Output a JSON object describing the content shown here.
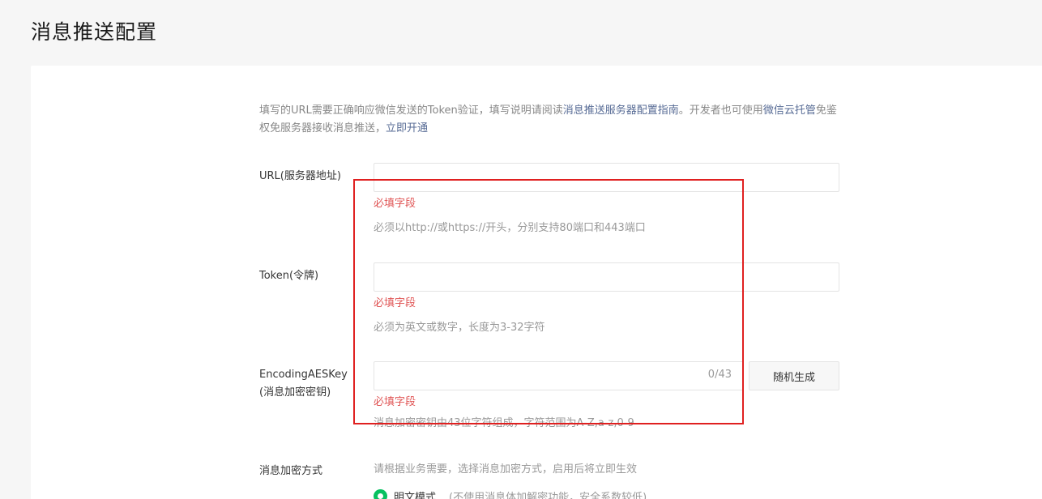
{
  "page": {
    "title": "消息推送配置"
  },
  "intro": {
    "text_1": "填写的URL需要正确响应微信发送的Token验证，填写说明请阅读",
    "link_guide": "消息推送服务器配置指南",
    "text_2": "。开发者也可使用",
    "link_cloud": "微信云托管",
    "text_3": "免鉴权免服务器接收消息推送，",
    "link_open": "立即开通"
  },
  "url_field": {
    "label": "URL(服务器地址)",
    "value": "",
    "error": "必填字段",
    "hint": "必须以http://或https://开头，分别支持80端口和443端口"
  },
  "token_field": {
    "label": "Token(令牌)",
    "value": "",
    "error": "必填字段",
    "hint": "必须为英文或数字，长度为3-32字符"
  },
  "aes_field": {
    "label_1": "EncodingAESKey",
    "label_2": "(消息加密密钥)",
    "value": "",
    "counter": "0/43",
    "generate_label": "随机生成",
    "error": "必填字段",
    "hint": "消息加密密钥由43位字符组成，字符范围为A-Z,a-z,0-9"
  },
  "encrypt_mode": {
    "label": "消息加密方式",
    "hint": "请根据业务需要，选择消息加密方式，启用后将立即生效",
    "option_plain": "明文模式",
    "option_plain_note": "(不使用消息体加解密功能，安全系数较低)"
  },
  "colors": {
    "accent_green": "#07c160",
    "error_red": "#e05555",
    "link_blue": "#576b95",
    "annotation_red": "#e02020"
  }
}
